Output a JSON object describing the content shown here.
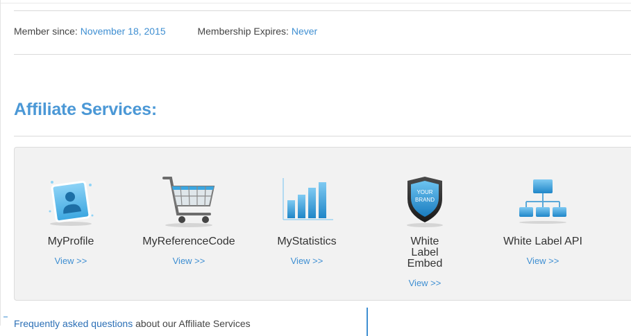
{
  "membership": {
    "since_label": "Member since:",
    "since_value": "November 18, 2015",
    "expires_label": "Membership Expires:",
    "expires_value": "Never"
  },
  "section_title": "Affiliate Services:",
  "services": [
    {
      "name": "MyProfile",
      "view": "View >>",
      "icon": "profile-icon"
    },
    {
      "name": "MyReferenceCode",
      "view": "View >>",
      "icon": "shopping-cart-icon"
    },
    {
      "name": "MyStatistics",
      "view": "View >>",
      "icon": "bar-chart-icon"
    },
    {
      "name": "White Label Embed",
      "view": "View >>",
      "icon": "shield-badge-icon",
      "badge_text": "YOUR BRAND"
    },
    {
      "name": "White Label API",
      "view": "View >>",
      "icon": "hierarchy-icon"
    }
  ],
  "faq": {
    "link": "Frequently asked questions",
    "rest": " about our Affiliate Services"
  },
  "colors": {
    "accent": "#4b98d6",
    "link": "#3f8fd2",
    "panel_bg": "#f2f2f2"
  }
}
